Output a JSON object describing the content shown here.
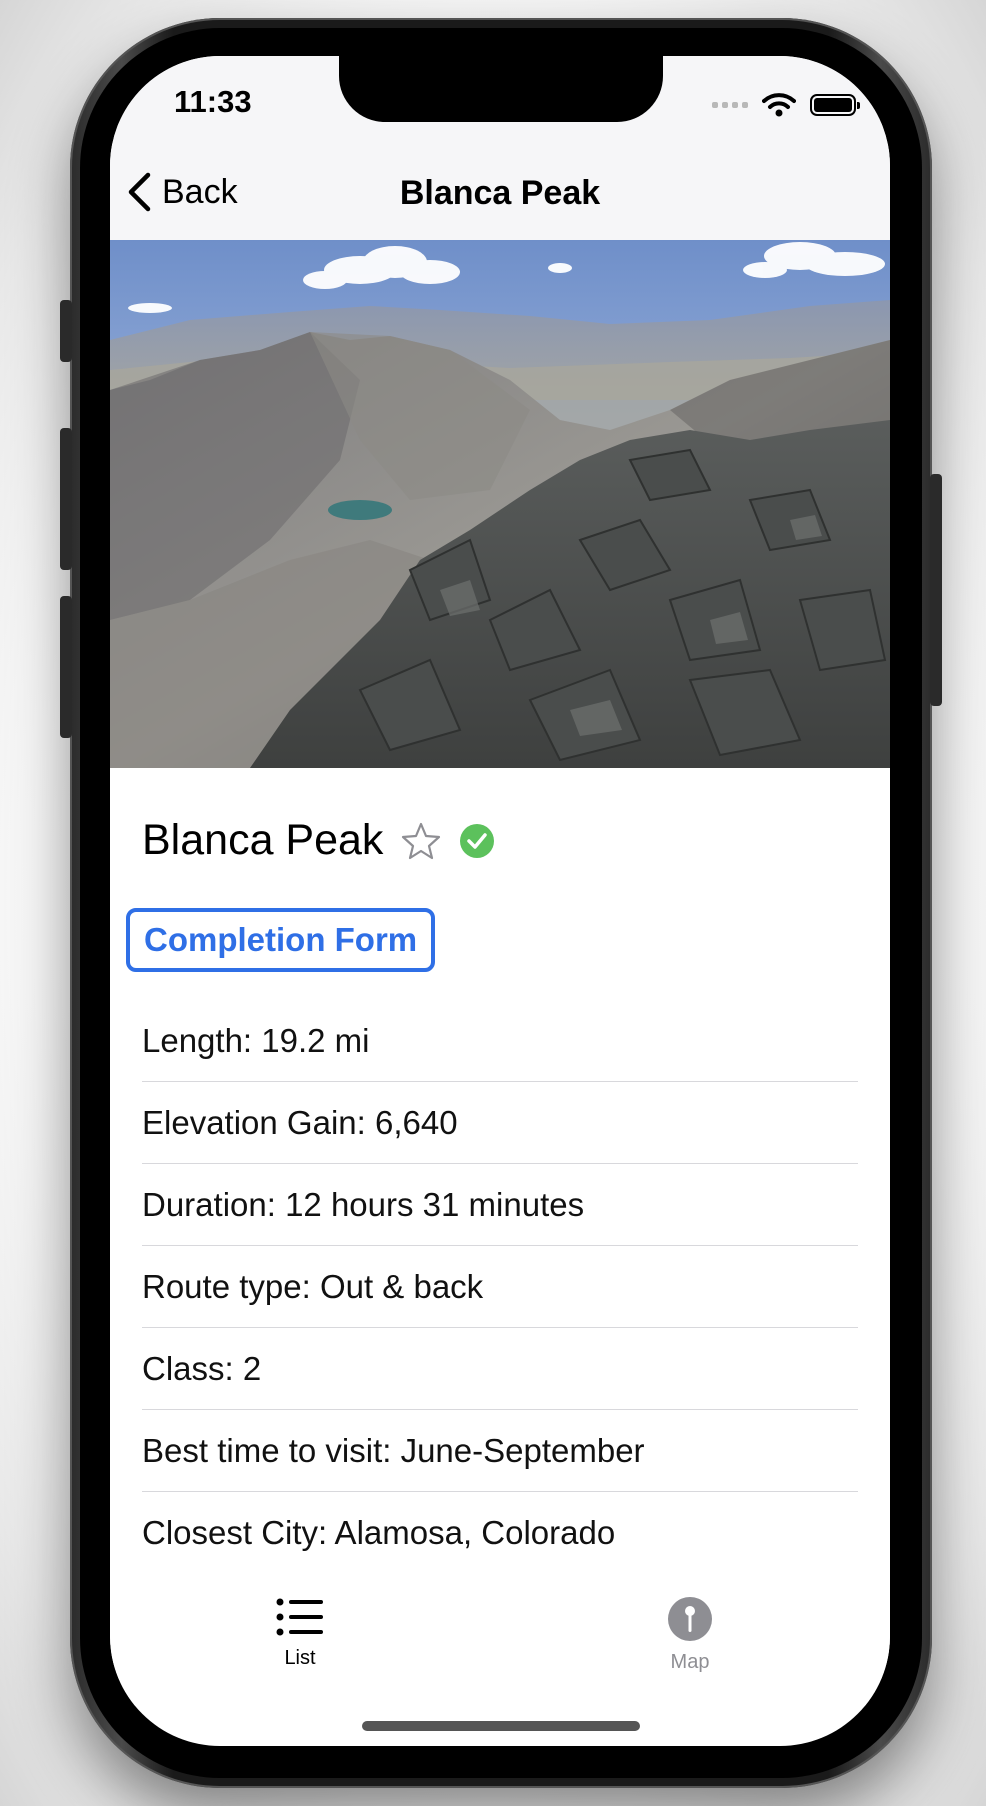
{
  "status": {
    "time": "11:33"
  },
  "nav": {
    "back_label": "Back",
    "title": "Blanca Peak"
  },
  "peak": {
    "name": "Blanca Peak",
    "favorite": false,
    "completed": true
  },
  "completion_form": {
    "label": "Completion Form"
  },
  "details": [
    {
      "text": "Length: 19.2 mi"
    },
    {
      "text": "Elevation Gain: 6,640"
    },
    {
      "text": "Duration: 12 hours 31 minutes"
    },
    {
      "text": "Route type: Out & back"
    },
    {
      "text": "Class: 2"
    },
    {
      "text": "Best time to visit: June-September"
    },
    {
      "text": "Closest City: Alamosa, Colorado"
    }
  ],
  "tabs": [
    {
      "label": "List",
      "icon": "list-icon",
      "selected": true
    },
    {
      "label": "Map",
      "icon": "map-pin-icon",
      "selected": false
    }
  ],
  "colors": {
    "accent": "#2f6fe6",
    "completed": "#5cc15c",
    "inactive": "#8e8e93"
  }
}
